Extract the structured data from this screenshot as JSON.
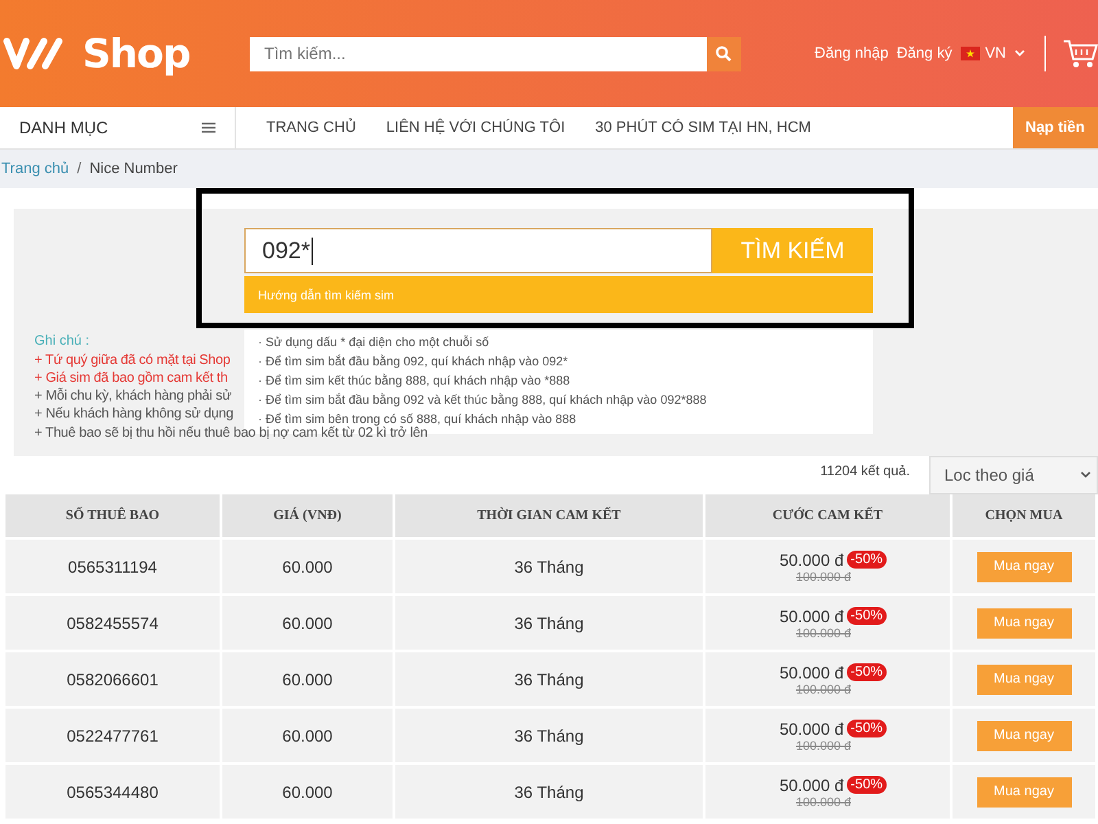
{
  "header": {
    "logo_text": "Shop",
    "search_placeholder": "Tìm kiếm...",
    "links": [
      "Đăng nhập",
      "Đăng ký"
    ],
    "language": "VN"
  },
  "nav": {
    "category": "DANH MỤC",
    "items": [
      "TRANG CHỦ",
      "LIÊN HỆ VỚI CHÚNG TÔI",
      "30 PHÚT CÓ SIM TẠI HN, HCM"
    ],
    "topup": "Nạp tiền"
  },
  "breadcrumb": [
    "Trang chủ",
    "Nice Number"
  ],
  "breadcrumb_separator": "/",
  "sim_search": {
    "value": "092*",
    "button": "TÌM KIẾM",
    "guide_title": "Hướng dẫn tìm kiếm sim",
    "guide_items": [
      "· Sử dụng dấu * đại diện cho một chuỗi số",
      "· Để tìm sim bắt đầu bằng 092, quí khách nhập vào 092*",
      "· Để tìm sim kết thúc bằng 888, quí khách nhập vào *888",
      "· Để tìm sim bắt đầu bằng 092 và kết thúc bằng 888, quí khách nhập vào 092*888",
      "· Để tìm sim bên trong có số 888, quí khách nhập vào 888"
    ]
  },
  "notes": {
    "title": "Ghi chú :",
    "lines": [
      {
        "kind": "highlight",
        "text": "+ Tứ quý giữa đã có mặt tại Shop"
      },
      {
        "kind": "highlight",
        "text": "+ Giá sim đã bao gồm cam kết th"
      },
      {
        "kind": "normal",
        "text": "+ Mỗi chu kỳ, khách hàng phải sử"
      },
      {
        "kind": "normal",
        "text": "+ Nếu khách hàng không sử dụng"
      },
      {
        "kind": "normal",
        "text": "+ Thuê bao sẽ bị thu hồi nếu thuê bao bị nợ cam kết từ 02 kì trở lên"
      }
    ]
  },
  "results_count": "11204 kết quả.",
  "sort_select": "Loc theo giá",
  "table": {
    "columns": [
      "SỐ THUÊ BAO",
      "GIÁ (VNĐ)",
      "THỜI GIAN CAM KẾT",
      "CƯỚC CAM KẾT",
      "CHỌN MUA"
    ],
    "rows": [
      {
        "number": "0565311194",
        "price": "60.000",
        "term": "36 Tháng",
        "fee": "50.000 đ",
        "discount": "-50%",
        "old_fee": "100.000 đ",
        "action": "Mua ngay"
      },
      {
        "number": "0582455574",
        "price": "60.000",
        "term": "36 Tháng",
        "fee": "50.000 đ",
        "discount": "-50%",
        "old_fee": "100.000 đ",
        "action": "Mua ngay"
      },
      {
        "number": "0582066601",
        "price": "60.000",
        "term": "36 Tháng",
        "fee": "50.000 đ",
        "discount": "-50%",
        "old_fee": "100.000 đ",
        "action": "Mua ngay"
      },
      {
        "number": "0522477761",
        "price": "60.000",
        "term": "36 Tháng",
        "fee": "50.000 đ",
        "discount": "-50%",
        "old_fee": "100.000 đ",
        "action": "Mua ngay"
      },
      {
        "number": "0565344480",
        "price": "60.000",
        "term": "36 Tháng",
        "fee": "50.000 đ",
        "discount": "-50%",
        "old_fee": "100.000 đ",
        "action": "Mua ngay"
      }
    ]
  }
}
